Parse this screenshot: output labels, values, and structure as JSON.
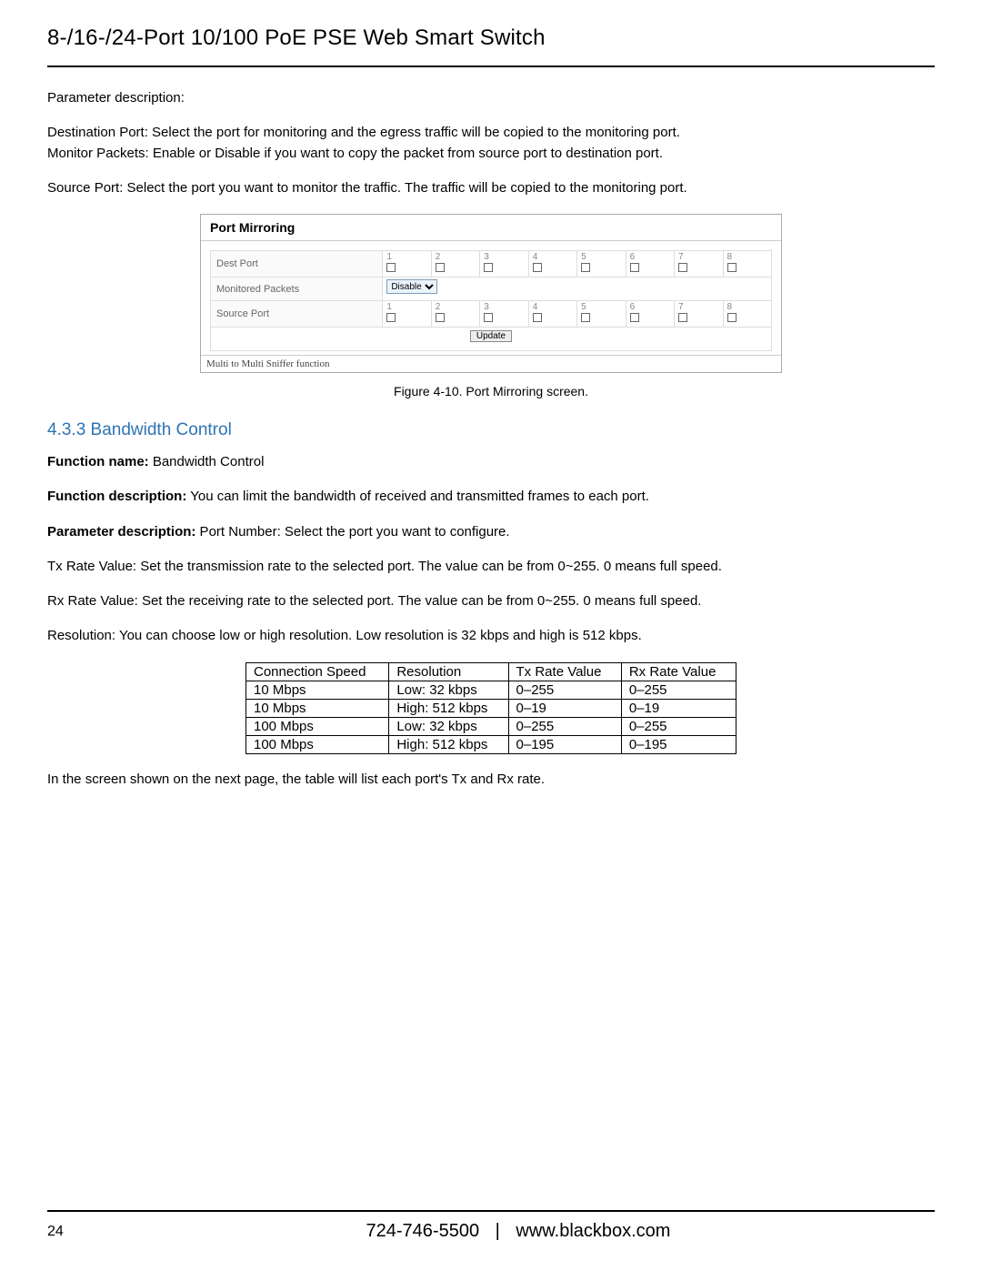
{
  "header": {
    "title": "8-/16-/24-Port 10/100 PoE PSE Web Smart Switch"
  },
  "intro": {
    "param_desc_label": "Parameter description:",
    "dest_port_text": "Destination Port: Select the port for monitoring and the egress traffic will be copied to the monitoring port.",
    "monitor_packets_text": "Monitor Packets: Enable or Disable if you want to copy the packet from source port to destination port.",
    "source_port_text": "Source Port: Select the port you want to monitor the traffic. The traffic will be copied to the monitoring port."
  },
  "port_mirroring": {
    "title": "Port Mirroring",
    "rows": {
      "dest_port": "Dest Port",
      "monitored_packets": "Monitored Packets",
      "source_port": "Source Port"
    },
    "ports": [
      "1",
      "2",
      "3",
      "4",
      "5",
      "6",
      "7",
      "8"
    ],
    "monitored_select": "Disable",
    "update_button": "Update",
    "footer": "Multi to Multi Sniffer function",
    "caption": "Figure 4-10. Port Mirroring screen."
  },
  "bandwidth": {
    "heading": "4.3.3 Bandwidth Control",
    "fn_name_label": "Function name:",
    "fn_name_value": " Bandwidth Control",
    "fn_desc_label": "Function description:",
    "fn_desc_value": " You can limit the bandwidth of received and transmitted frames to each port.",
    "param_desc_label": "Parameter description:",
    "param_desc_value": " Port Number: Select the port you want to configure.",
    "tx_rate_text": "Tx Rate Value: Set the transmission rate to the selected port. The value can be from 0~255. 0 means full speed.",
    "rx_rate_text": "Rx Rate Value: Set the receiving rate to the selected port. The value can be from 0~255. 0 means full speed.",
    "resolution_text": "Resolution: You can choose low or high resolution. Low resolution is 32 kbps and high is 512 kbps.",
    "table_headers": {
      "c1": "Connection Speed",
      "c2": "Resolution",
      "c3": "Tx Rate Value",
      "c4": "Rx Rate Value"
    },
    "table_rows": [
      {
        "c1": "10 Mbps",
        "c2": "Low: 32 kbps",
        "c3": "0–255",
        "c4": "0–255"
      },
      {
        "c1": "10 Mbps",
        "c2": "High: 512 kbps",
        "c3": "0–19",
        "c4": "0–19"
      },
      {
        "c1": "100 Mbps",
        "c2": "Low: 32 kbps",
        "c3": "0–255",
        "c4": "0–255"
      },
      {
        "c1": "100 Mbps",
        "c2": "High: 512 kbps",
        "c3": "0–195",
        "c4": "0–195"
      }
    ],
    "post_table_text": "In the screen shown on the next page, the table will list each port's Tx and Rx rate."
  },
  "footer": {
    "page_number": "24",
    "phone": "724-746-5500",
    "separator": "|",
    "url": "www.blackbox.com"
  },
  "chart_data": {
    "type": "table",
    "title": "Bandwidth Control reference table",
    "columns": [
      "Connection Speed",
      "Resolution",
      "Tx Rate Value",
      "Rx Rate Value"
    ],
    "rows": [
      [
        "10 Mbps",
        "Low: 32 kbps",
        "0–255",
        "0–255"
      ],
      [
        "10 Mbps",
        "High: 512 kbps",
        "0–19",
        "0–19"
      ],
      [
        "100 Mbps",
        "Low: 32 kbps",
        "0–255",
        "0–255"
      ],
      [
        "100 Mbps",
        "High: 512 kbps",
        "0–195",
        "0–195"
      ]
    ]
  }
}
